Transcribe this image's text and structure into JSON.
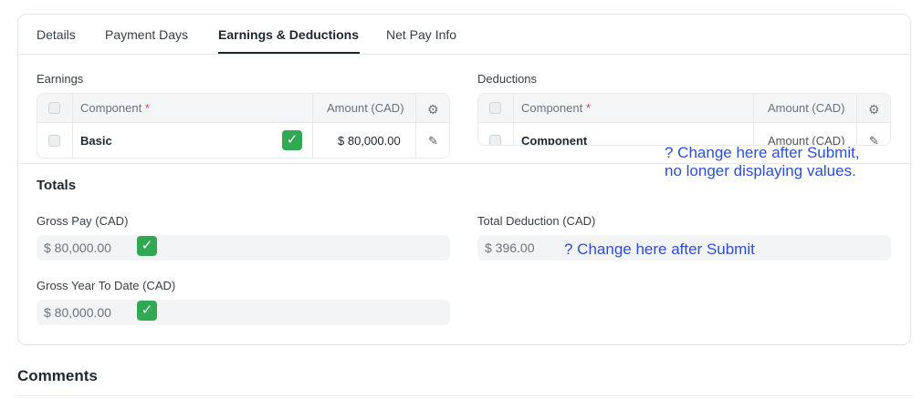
{
  "tabs": [
    {
      "label": "Details"
    },
    {
      "label": "Payment Days"
    },
    {
      "label": "Earnings & Deductions"
    },
    {
      "label": "Net Pay Info"
    }
  ],
  "earnings": {
    "section_label": "Earnings",
    "headers": {
      "component": "Component",
      "required_mark": "*",
      "amount": "Amount (CAD)"
    },
    "rows": [
      {
        "component": "Basic",
        "amount": "$ 80,000.00",
        "check": "✓"
      }
    ]
  },
  "deductions": {
    "section_label": "Deductions",
    "headers": {
      "component": "Component",
      "required_mark": "*",
      "amount": "Amount (CAD)"
    },
    "rows": [
      {
        "component": "Component",
        "amount": "Amount (CAD)"
      }
    ]
  },
  "totals": {
    "title": "Totals",
    "gross_pay": {
      "label": "Gross Pay (CAD)",
      "value": "$ 80,000.00",
      "check": "✓"
    },
    "total_deduction": {
      "label": "Total Deduction (CAD)",
      "value": "$ 396.00"
    },
    "gross_ytd": {
      "label": "Gross Year To Date (CAD)",
      "value": "$ 80,000.00",
      "check": "✓"
    }
  },
  "annotations": {
    "deductions_note_line1": "? Change here after Submit,",
    "deductions_note_line2": "no longer displaying values.",
    "total_deduction_note": "? Change here after Submit"
  },
  "comments": {
    "title": "Comments"
  },
  "colors": {
    "annotation": "#2c4fd6",
    "check": "#33a853",
    "required": "#e24c4c"
  }
}
